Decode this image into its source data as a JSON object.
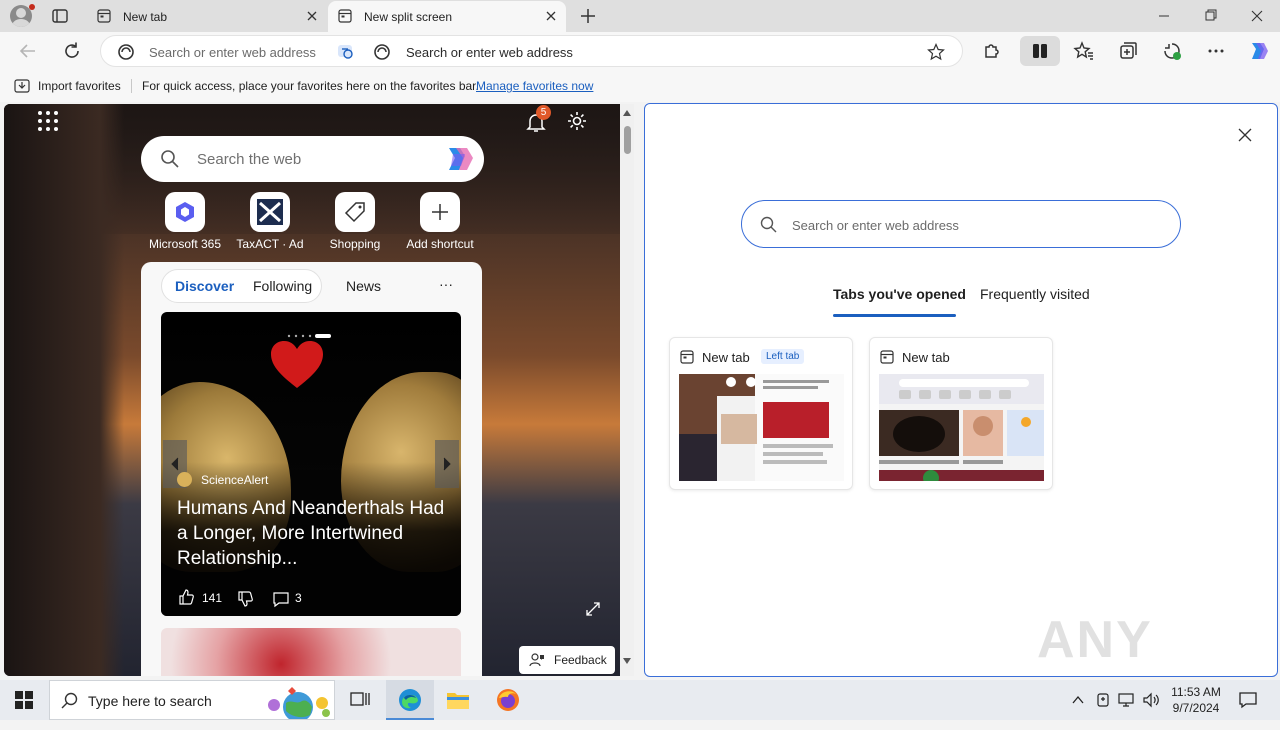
{
  "tabs": [
    {
      "title": "New tab",
      "icon": "tab-page-icon",
      "active": false
    },
    {
      "title": "New split screen",
      "icon": "tab-page-icon",
      "active": true
    }
  ],
  "address_bar": {
    "left_placeholder": "Search or enter web address",
    "right_placeholder": "Search or enter web address"
  },
  "favorites_bar": {
    "import_label": "Import favorites",
    "hint_text": "For quick access, place your favorites here on the favorites bar.",
    "manage_link": "Manage favorites now"
  },
  "left_pane": {
    "notification_count": "5",
    "search_placeholder": "Search the web",
    "shortcuts": [
      {
        "label": "Microsoft 365",
        "icon": "microsoft-365-icon"
      },
      {
        "label": "TaxACT · Ad",
        "icon": "taxact-icon"
      },
      {
        "label": "Shopping",
        "icon": "shopping-tag-icon"
      },
      {
        "label": "Add shortcut",
        "icon": "plus-icon"
      }
    ],
    "feed_tabs": [
      "Discover",
      "Following",
      "News"
    ],
    "more_label": "···",
    "hero": {
      "source": "ScienceAlert",
      "title": "Humans And Neanderthals Had a Longer, More Intertwined Relationship...",
      "likes": "141",
      "comments": "3"
    },
    "feedback_label": "Feedback"
  },
  "right_pane": {
    "search_placeholder": "Search or enter web address",
    "tabs": [
      "Tabs you've opened",
      "Frequently visited"
    ],
    "cards": [
      {
        "title": "New tab",
        "badge": "Left tab"
      },
      {
        "title": "New tab",
        "badge": ""
      }
    ]
  },
  "watermark": "ANY RUN",
  "taskbar": {
    "search_placeholder": "Type here to search",
    "time": "11:53 AM",
    "date": "9/7/2024"
  },
  "colors": {
    "accent": "#1b5fbf",
    "split_border": "#3a6ed8",
    "notification_badge": "#e0592a"
  }
}
